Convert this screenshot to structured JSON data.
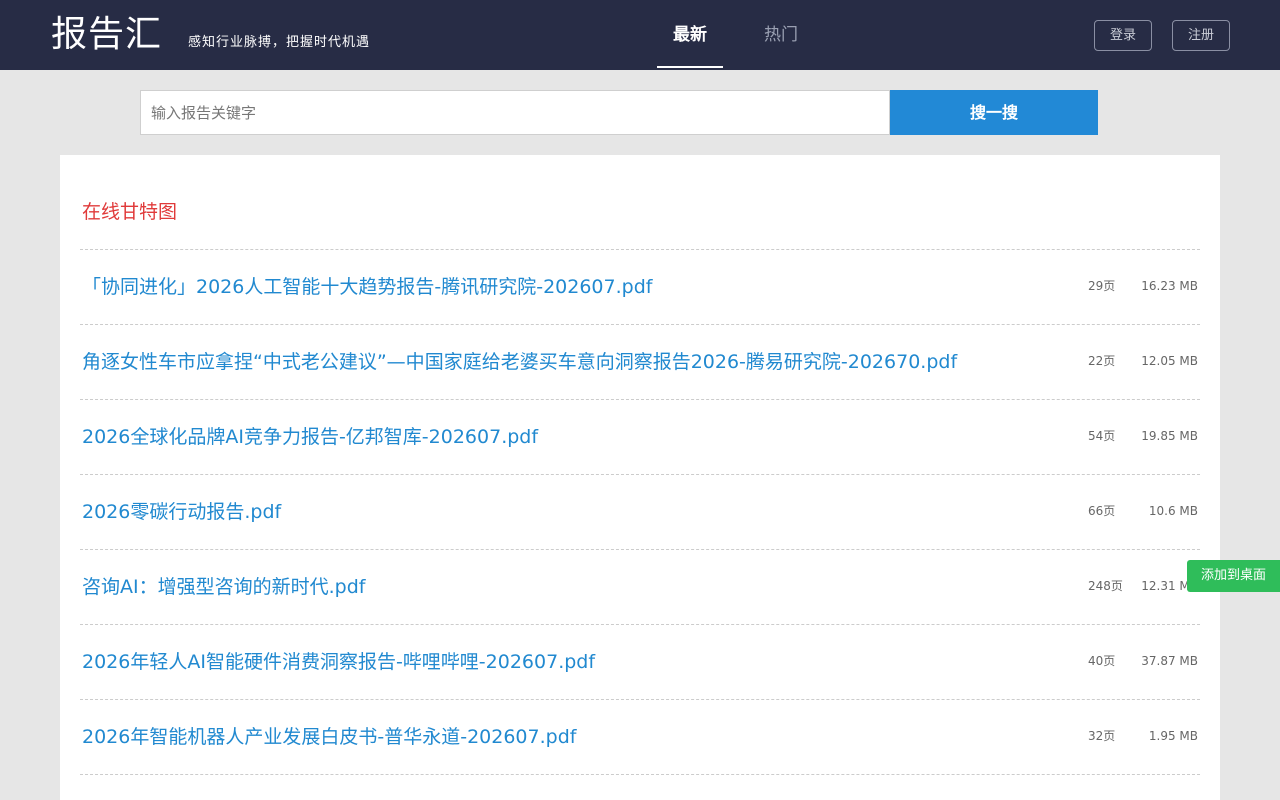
{
  "header": {
    "brand": "报告汇",
    "slogan": "感知行业脉搏，把握时代机遇",
    "tabs": [
      {
        "label": "最新",
        "active": true
      },
      {
        "label": "热门",
        "active": false
      }
    ],
    "login_label": "登录",
    "register_label": "注册"
  },
  "search": {
    "placeholder": "输入报告关键字",
    "value": "",
    "button_label": "搜一搜"
  },
  "section": {
    "title": "在线甘特图"
  },
  "reports": [
    {
      "title": "「协同进化」2026人工智能十大趋势报告-腾讯研究院-202607.pdf",
      "pages": "29页",
      "size": "16.23 MB"
    },
    {
      "title": "角逐女性车市应拿捏“中式老公建议”—中国家庭给老婆买车意向洞察报告2026-腾易研究院-202670.pdf",
      "pages": "22页",
      "size": "12.05 MB"
    },
    {
      "title": "2026全球化品牌AI竞争力报告-亿邦智库-202607.pdf",
      "pages": "54页",
      "size": "19.85 MB"
    },
    {
      "title": "2026零碳行动报告.pdf",
      "pages": "66页",
      "size": "10.6 MB"
    },
    {
      "title": "咨询AI：增强型咨询的新时代.pdf",
      "pages": "248页",
      "size": "12.31 MB"
    },
    {
      "title": "2026年轻人AI智能硬件消费洞察报告-哔哩哔哩-202607.pdf",
      "pages": "40页",
      "size": "37.87 MB"
    },
    {
      "title": "2026年智能机器人产业发展白皮书-普华永道-202607.pdf",
      "pages": "32页",
      "size": "1.95 MB"
    }
  ],
  "floating": {
    "add_desktop_label": "添加到桌面"
  },
  "colors": {
    "header_bg": "#272c45",
    "accent_blue": "#2289d6",
    "title_red": "#e03a3a",
    "link_blue": "#2189d0",
    "float_green": "#2fbd5a"
  }
}
